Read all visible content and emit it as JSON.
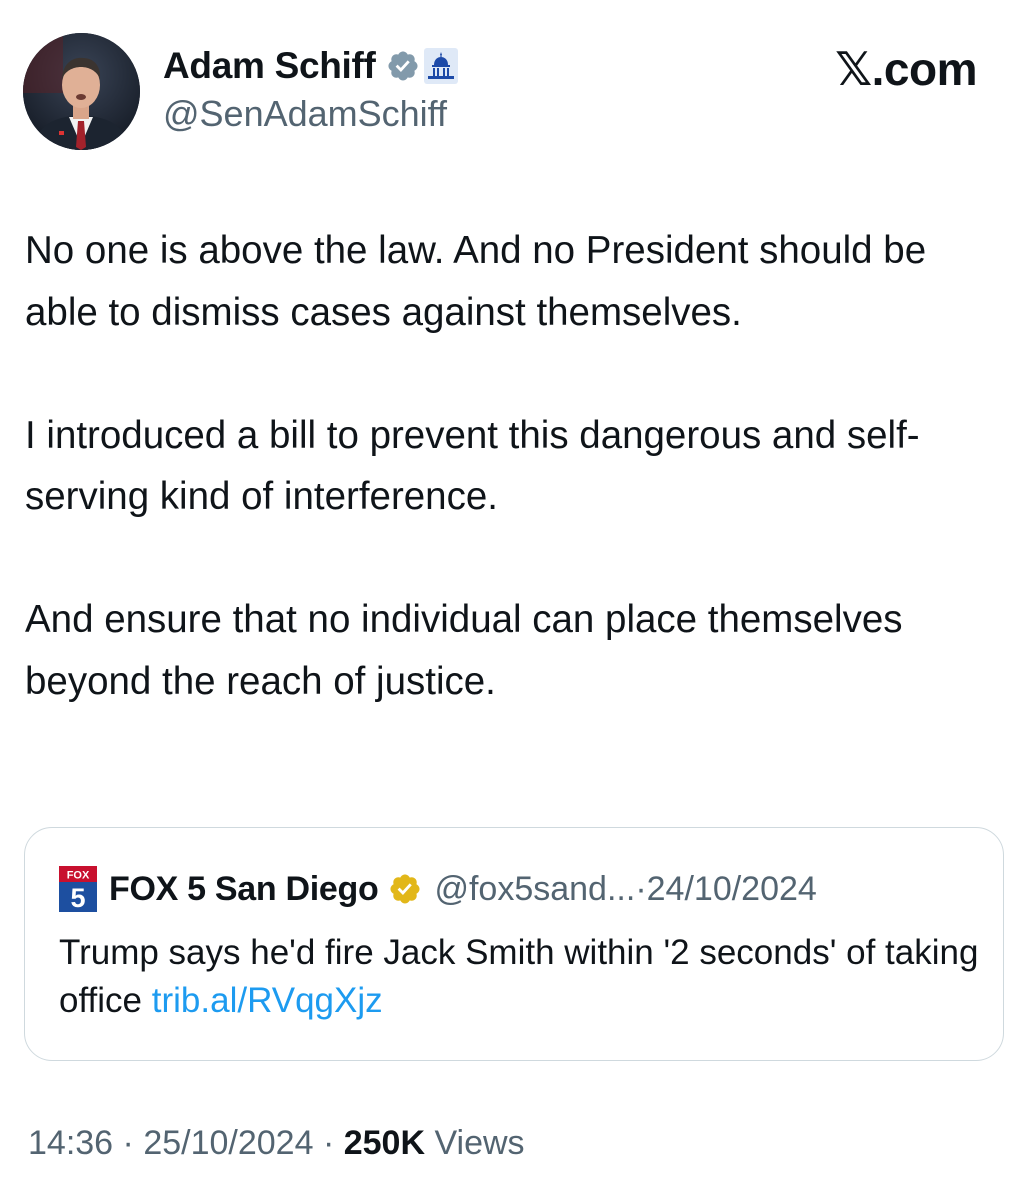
{
  "author": {
    "name": "Adam Schiff",
    "handle": "@SenAdamSchiff",
    "verified": true,
    "affiliation_badge": "capitol-icon"
  },
  "site_logo": "𝕏.com",
  "tweet": {
    "paragraphs": [
      "No one is above the law. And no President should be able to dismiss cases against themselves.",
      "I introduced a bill to prevent this dangerous and self-serving kind of interference.",
      "And ensure that no individual can place themselves beyond the reach of justice."
    ]
  },
  "quoted_tweet": {
    "logo_icon": "fox5-logo-icon",
    "name": "FOX 5 San Diego",
    "verified_gold": true,
    "handle": "@fox5sand...",
    "separator": "·",
    "date": "24/10/2024",
    "text": "Trump says he'd fire Jack Smith within '2 seconds' of taking office",
    "link": "trib.al/RVqgXjz"
  },
  "meta": {
    "time": "14:36",
    "separator": "·",
    "date": "25/10/2024",
    "views_count": "250K",
    "views_label": "Views"
  },
  "colors": {
    "text": "#0f1419",
    "secondary": "#536471",
    "link": "#1d9bf0",
    "border": "#cfd9de",
    "verified_gray": "#829aab",
    "verified_gold": "#e2b719"
  }
}
